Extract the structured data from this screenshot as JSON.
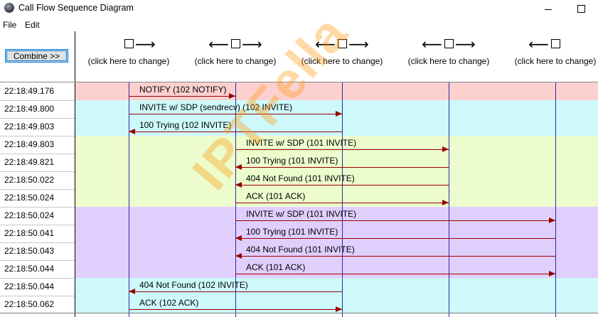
{
  "window": {
    "title": "Call Flow Sequence Diagram"
  },
  "menu": {
    "items": [
      "File",
      "Edit"
    ]
  },
  "header": {
    "combine_label": "Combine >>",
    "column_label": "(click here to change)",
    "columns": [
      {
        "left_arrow": "",
        "right_arrow": "⟶"
      },
      {
        "left_arrow": "⟵",
        "right_arrow": "⟶"
      },
      {
        "left_arrow": "⟵",
        "right_arrow": "⟶"
      },
      {
        "left_arrow": "⟵",
        "right_arrow": "⟶"
      },
      {
        "left_arrow": "⟵",
        "right_arrow": ""
      }
    ]
  },
  "colors": {
    "pink": "#fdd0d0",
    "cyan": "#cef9fb",
    "lime": "#ecfccd",
    "lavender": "#e0cffd",
    "lifeline": "#2a2aa0",
    "arrow": "#9a0000"
  },
  "watermark": "IPTFella",
  "rows": [
    {
      "time": "22:18:49.176",
      "band": "pink",
      "label": "NOTIFY (102 NOTIFY)",
      "from": 0,
      "to": 1
    },
    {
      "time": "22:18:49.800",
      "band": "cyan",
      "label": "INVITE w/ SDP (sendrecv)  (102 INVITE)",
      "from": 0,
      "to": 2
    },
    {
      "time": "22:18:49.803",
      "band": "cyan",
      "label": "100 Trying (102 INVITE)",
      "from": 2,
      "to": 0
    },
    {
      "time": "22:18:49.803",
      "band": "lime",
      "label": "INVITE w/ SDP (101 INVITE)",
      "from": 1,
      "to": 3
    },
    {
      "time": "22:18:49.821",
      "band": "lime",
      "label": "100 Trying (101 INVITE)",
      "from": 3,
      "to": 1
    },
    {
      "time": "22:18:50.022",
      "band": "lime",
      "label": "404 Not Found (101 INVITE)",
      "from": 3,
      "to": 1
    },
    {
      "time": "22:18:50.024",
      "band": "lime",
      "label": "ACK (101 ACK)",
      "from": 1,
      "to": 3
    },
    {
      "time": "22:18:50.024",
      "band": "lavender",
      "label": "INVITE w/ SDP (101 INVITE)",
      "from": 1,
      "to": 4
    },
    {
      "time": "22:18:50.041",
      "band": "lavender",
      "label": "100 Trying (101 INVITE)",
      "from": 4,
      "to": 1
    },
    {
      "time": "22:18:50.043",
      "band": "lavender",
      "label": "404 Not Found (101 INVITE)",
      "from": 4,
      "to": 1
    },
    {
      "time": "22:18:50.044",
      "band": "lavender",
      "label": "ACK (101 ACK)",
      "from": 1,
      "to": 4
    },
    {
      "time": "22:18:50.044",
      "band": "cyan",
      "label": "404 Not Found (102 INVITE)",
      "from": 2,
      "to": 0
    },
    {
      "time": "22:18:50.062",
      "band": "cyan",
      "label": "ACK (102 ACK)",
      "from": 0,
      "to": 2
    }
  ]
}
